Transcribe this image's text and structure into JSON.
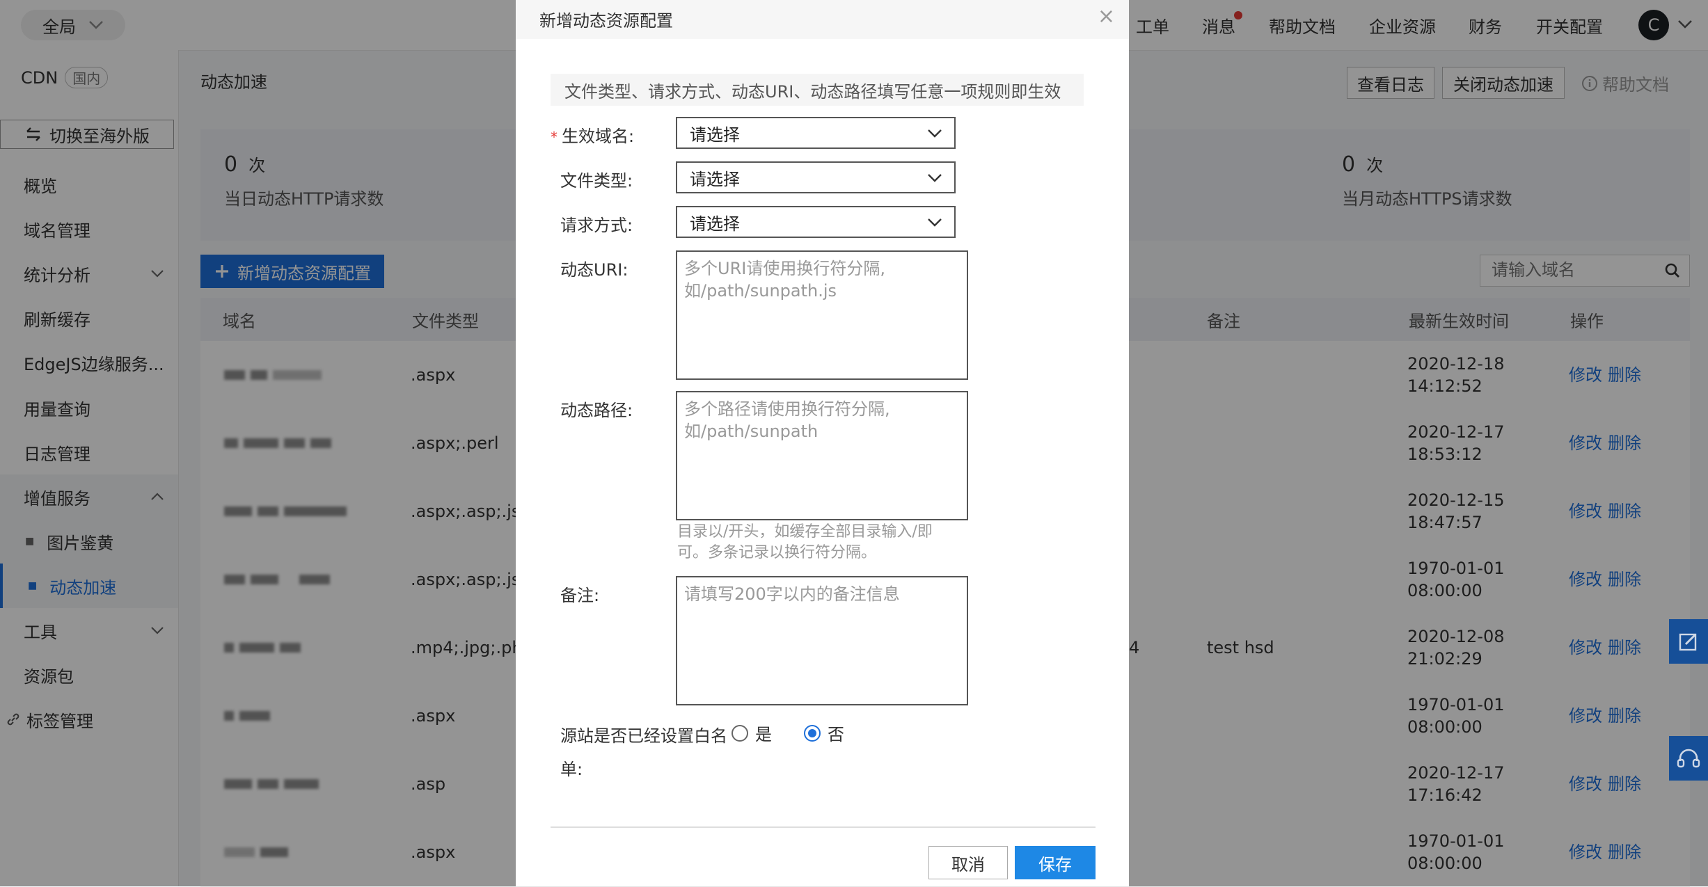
{
  "topbar": {
    "scope": "全局",
    "nav": [
      "工单",
      "消息",
      "帮助文档",
      "企业资源",
      "财务",
      "开关配置"
    ],
    "avatar": "C"
  },
  "sidebar": {
    "title": "CDN",
    "tag": "国内",
    "switch": "切换至海外版",
    "items": [
      "概览",
      "域名管理",
      "统计分析",
      "刷新缓存",
      "EdgeJS边缘服务...",
      "用量查询",
      "日志管理",
      "增值服务",
      "图片鉴黄",
      "动态加速",
      "工具",
      "资源包",
      "标签管理"
    ]
  },
  "page": {
    "breadcrumb": "动态加速",
    "view_log": "查看日志",
    "close_accel": "关闭动态加速",
    "help": "帮助文档",
    "stats": {
      "http_count": "0",
      "http_unit": "次",
      "http_label": "当日动态HTTP请求数",
      "https_count": "0",
      "https_unit": "次",
      "https_label": "当月动态HTTPS请求数"
    },
    "add_button": "新增动态资源配置",
    "search_placeholder": "请输入域名",
    "columns": {
      "domain": "域名",
      "file_type": "文件类型",
      "remark": "备注",
      "time": "最新生效时间",
      "ops": "操作"
    },
    "rows": [
      {
        "file_type": ".aspx",
        "remark": "",
        "extra": "",
        "date": "2020-12-18",
        "time": "14:12:52"
      },
      {
        "file_type": ".aspx;.perl",
        "remark": "",
        "extra": "",
        "date": "2020-12-17",
        "time": "18:53:12"
      },
      {
        "file_type": ".aspx;.asp;.jsp",
        "remark": "",
        "extra": "",
        "date": "2020-12-15",
        "time": "18:47:57"
      },
      {
        "file_type": ".aspx;.asp;.jsp",
        "remark": "",
        "extra": "",
        "date": "1970-01-01",
        "time": "08:00:00"
      },
      {
        "file_type": ".mp4;.jpg;.ph",
        "remark": "test hsd",
        "extra": "4",
        "date": "2020-12-08",
        "time": "21:02:29"
      },
      {
        "file_type": ".aspx",
        "remark": "",
        "extra": "",
        "date": "1970-01-01",
        "time": "08:00:00"
      },
      {
        "file_type": ".asp",
        "remark": "",
        "extra": "",
        "date": "2020-12-17",
        "time": "17:16:42"
      },
      {
        "file_type": ".aspx",
        "remark": "",
        "extra": "",
        "date": "1970-01-01",
        "time": "08:00:00"
      }
    ],
    "op_edit": "修改",
    "op_delete": "删除"
  },
  "modal": {
    "title": "新增动态资源配置",
    "tip": "文件类型、请求方式、动态URI、动态路径填写任意一项规则即生效",
    "domain_label": "生效域名:",
    "file_type_label": "文件类型:",
    "method_label": "请求方式:",
    "select_placeholder": "请选择",
    "uri_label": "动态URI:",
    "uri_placeholder": "多个URI请使用换行符分隔,\n如/path/sunpath.js",
    "path_label": "动态路径:",
    "path_placeholder": "多个路径请使用换行符分隔,\n如/path/sunpath",
    "path_hint": "目录以/开头，如缓存全部目录输入/即可。多条记录以换行符分隔。",
    "remark_label": "备注:",
    "remark_placeholder": "请填写200字以内的备注信息",
    "whitelist_label_1": "源站是否已经设置白名",
    "whitelist_label_2": "单:",
    "yes": "是",
    "no": "否",
    "whitelist_value": "否",
    "cancel": "取消",
    "save": "保存"
  }
}
